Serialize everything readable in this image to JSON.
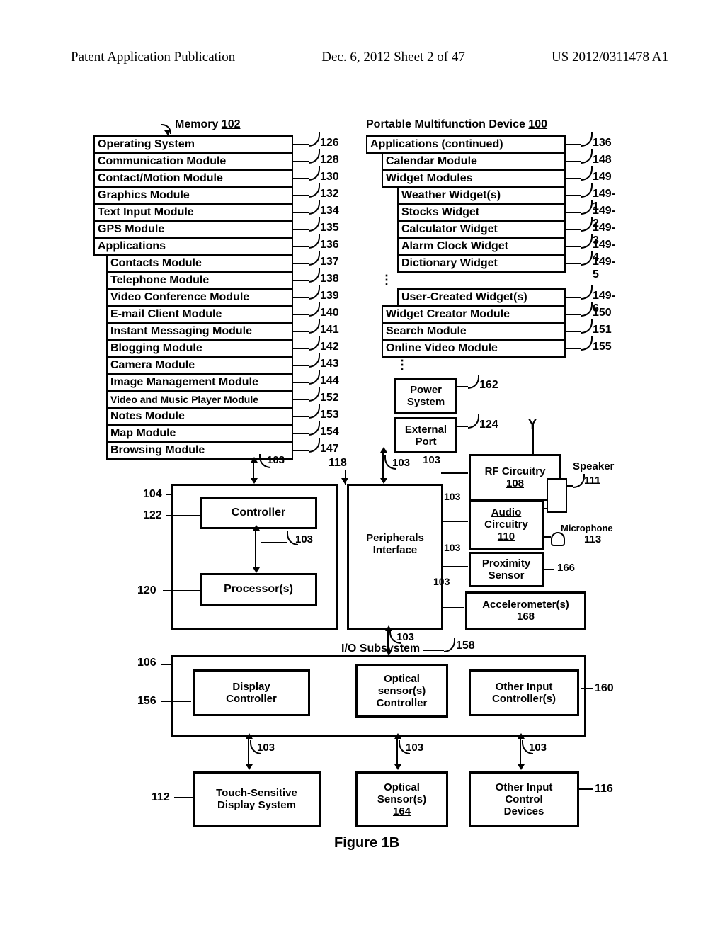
{
  "header": {
    "left": "Patent Application Publication",
    "mid": "Dec. 6, 2012  Sheet 2 of 47",
    "right": "US 2012/0311478 A1"
  },
  "fig_label": "Figure 1B",
  "memory_label": "Memory 102",
  "device_label": "Portable Multifunction Device 100",
  "left_list": {
    "items": [
      {
        "text": "Operating System",
        "num": "126"
      },
      {
        "text": "Communication Module",
        "num": "128"
      },
      {
        "text": "Contact/Motion Module",
        "num": "130"
      },
      {
        "text": "Graphics Module",
        "num": "132"
      },
      {
        "text": "Text Input Module",
        "num": "134"
      },
      {
        "text": "GPS Module",
        "num": "135"
      },
      {
        "text": "Applications",
        "num": "136"
      },
      {
        "text": "Contacts Module",
        "num": "137",
        "indent": 1
      },
      {
        "text": "Telephone Module",
        "num": "138",
        "indent": 1
      },
      {
        "text": "Video Conference Module",
        "num": "139",
        "indent": 1
      },
      {
        "text": "E-mail Client Module",
        "num": "140",
        "indent": 1
      },
      {
        "text": "Instant Messaging Module",
        "num": "141",
        "indent": 1
      },
      {
        "text": "Blogging Module",
        "num": "142",
        "indent": 1
      },
      {
        "text": "Camera Module",
        "num": "143",
        "indent": 1
      },
      {
        "text": "Image Management Module",
        "num": "144",
        "indent": 1
      },
      {
        "text": "Video and Music Player Module",
        "num": "152",
        "indent": 1,
        "small": true
      },
      {
        "text": "Notes Module",
        "num": "153",
        "indent": 1
      },
      {
        "text": "Map Module",
        "num": "154",
        "indent": 1
      },
      {
        "text": "Browsing Module",
        "num": "147",
        "indent": 1
      }
    ]
  },
  "right_list": {
    "header": {
      "text": "Applications (continued)",
      "num": "136"
    },
    "items": [
      {
        "text": "Calendar Module",
        "num": "148",
        "indent": 1
      },
      {
        "text": "Widget Modules",
        "num": "149",
        "indent": 1
      },
      {
        "text": "Weather Widget(s)",
        "num": "149-1",
        "indent": 2
      },
      {
        "text": "Stocks Widget",
        "num": "149-2",
        "indent": 2
      },
      {
        "text": "Calculator Widget",
        "num": "149-3",
        "indent": 2
      },
      {
        "text": "Alarm Clock Widget",
        "num": "149-4",
        "indent": 2
      },
      {
        "text": "Dictionary Widget",
        "num": "149-5",
        "indent": 2
      },
      {
        "vdots": true
      },
      {
        "text": "User-Created Widget(s)",
        "num": "149-6",
        "indent": 2
      },
      {
        "text": "Widget Creator Module",
        "num": "150",
        "indent": 1
      },
      {
        "text": "Search Module",
        "num": "151",
        "indent": 1
      },
      {
        "text": "Online Video Module",
        "num": "155",
        "indent": 1
      },
      {
        "vdots": true,
        "indent": 1
      }
    ]
  },
  "blocks": {
    "power": {
      "line1": "Power",
      "line2": "System",
      "num": "162"
    },
    "ext": {
      "line1": "External",
      "line2": "Port",
      "num": "124"
    },
    "rf": {
      "line1": "RF Circuitry",
      "line2u": "108"
    },
    "aud": {
      "line1": "Audio",
      "line2": "Circuitry",
      "line3u": "110"
    },
    "prox": {
      "line1": "Proximity",
      "line2": "Sensor",
      "num": "166"
    },
    "accel": {
      "line1": "Accelerometer(s)",
      "line2u": "168"
    },
    "speaker": "Speaker",
    "spk_num": "111",
    "mic": "Microphone",
    "mic_num": "113",
    "ctrl104": "104",
    "ctrl122": "122",
    "controller": "Controller",
    "proc": "Processor(s)",
    "proc120": "120",
    "periph": {
      "line1": "Peripherals",
      "line2": "Interface"
    },
    "n118": "118",
    "n103": "103",
    "io": "I/O Subsystem",
    "io_num": "158",
    "io106": "106",
    "dsp": {
      "line1": "Display",
      "line2": "Controller"
    },
    "dsp156": "156",
    "opt": {
      "line1": "Optical",
      "line2": "sensor(s)",
      "line3": "Controller"
    },
    "oic": {
      "line1": "Other Input",
      "line2": "Controller(s)"
    },
    "oic160": "160",
    "tsd": {
      "line1": "Touch-Sensitive",
      "line2": "Display System"
    },
    "tsd112": "112",
    "os": {
      "line1": "Optical",
      "line2": "Sensor(s)",
      "line3u": "164"
    },
    "oid": {
      "line1": "Other Input",
      "line2": "Control",
      "line3": "Devices"
    },
    "oid116": "116"
  }
}
